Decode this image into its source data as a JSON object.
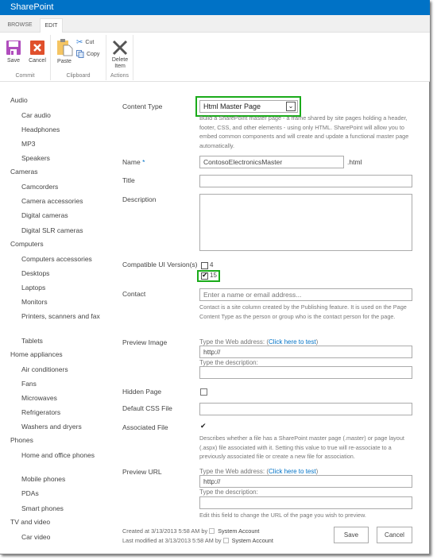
{
  "app": {
    "title": "SharePoint"
  },
  "tabs": [
    {
      "label": "BROWSE"
    },
    {
      "label": "EDIT"
    }
  ],
  "ribbon": {
    "commit": {
      "label": "Commit",
      "save": "Save",
      "cancel": "Cancel"
    },
    "clipboard": {
      "label": "Clipboard",
      "paste": "Paste",
      "cut": "Cut",
      "copy": "Copy"
    },
    "actions": {
      "label": "Actions",
      "delete_line1": "Delete",
      "delete_line2": "Item"
    }
  },
  "nav": {
    "groups": [
      {
        "label": "Audio",
        "items": [
          "Car audio",
          "Headphones",
          "MP3",
          "Speakers"
        ]
      },
      {
        "label": "Cameras",
        "items": [
          "Camcorders",
          "Camera accessories",
          "Digital cameras",
          "Digital SLR cameras"
        ]
      },
      {
        "label": "Computers",
        "items": [
          "Computers accessories",
          "Desktops",
          "Laptops",
          "Monitors",
          "Printers, scanners and fax",
          "Tablets"
        ]
      },
      {
        "label": "Home appliances",
        "items": [
          "Air conditioners",
          "Fans",
          "Microwaves",
          "Refrigerators",
          "Washers and dryers"
        ]
      },
      {
        "label": "Phones",
        "items": [
          "Home and office phones",
          "Mobile phones",
          "PDAs",
          "Smart phones"
        ]
      },
      {
        "label": "TV and video",
        "items": [
          "Car video"
        ]
      }
    ]
  },
  "form": {
    "content_type": {
      "label": "Content Type",
      "value": "Html Master Page",
      "help": "Build a SharePoint master page - a frame shared by site pages holding a header, footer, CSS, and other elements - using only HTML.  SharePoint will allow you to embed common components and will create and update a functional master page automatically."
    },
    "name": {
      "label": "Name",
      "required_mark": "*",
      "value": "ContosoElectronicsMaster",
      "suffix": ".html"
    },
    "title": {
      "label": "Title",
      "value": ""
    },
    "description": {
      "label": "Description",
      "value": ""
    },
    "compat": {
      "label": "Compatible UI Version(s)",
      "options": [
        {
          "label": "4",
          "checked": false
        },
        {
          "label": "15",
          "checked": true
        }
      ]
    },
    "contact": {
      "label": "Contact",
      "placeholder": "Enter a name or email address...",
      "help": "Contact is a site column created by the Publishing feature. It is used on the Page Content Type as the person or group who is the contact person for the page."
    },
    "preview_image": {
      "label": "Preview Image",
      "web_address_label": "Type the Web address: (",
      "test_link": "Click here to test",
      "web_address_close": ")",
      "url_value": "http://",
      "desc_label": "Type the description:",
      "desc_value": ""
    },
    "hidden_page": {
      "label": "Hidden Page",
      "checked": false
    },
    "default_css": {
      "label": "Default CSS File",
      "value": ""
    },
    "associated_file": {
      "label": "Associated File",
      "checked": true,
      "help": "Describes whether a file has a SharePoint master page (.master) or page layout (.aspx) file associated with it. Setting this value to true will re-associate to a previously associated file or create a new file for association."
    },
    "preview_url": {
      "label": "Preview URL",
      "web_address_label": "Type the Web address: (",
      "test_link": "Click here to test",
      "web_address_close": ")",
      "url_value": "http://",
      "desc_label": "Type the description:",
      "desc_value": "",
      "help": "Edit this field to change the URL of the page you wish to preview."
    }
  },
  "footer": {
    "created": "Created at 3/13/2013 5:58 AM  by",
    "created_by": "System Account",
    "modified": "Last modified at 3/13/2013 5:58 AM  by",
    "modified_by": "System Account",
    "save": "Save",
    "cancel": "Cancel"
  },
  "colors": {
    "brand": "#0072c6",
    "highlight": "#1aab1a",
    "save_icon": "#b04dbd",
    "cancel_icon": "#e0502c"
  }
}
